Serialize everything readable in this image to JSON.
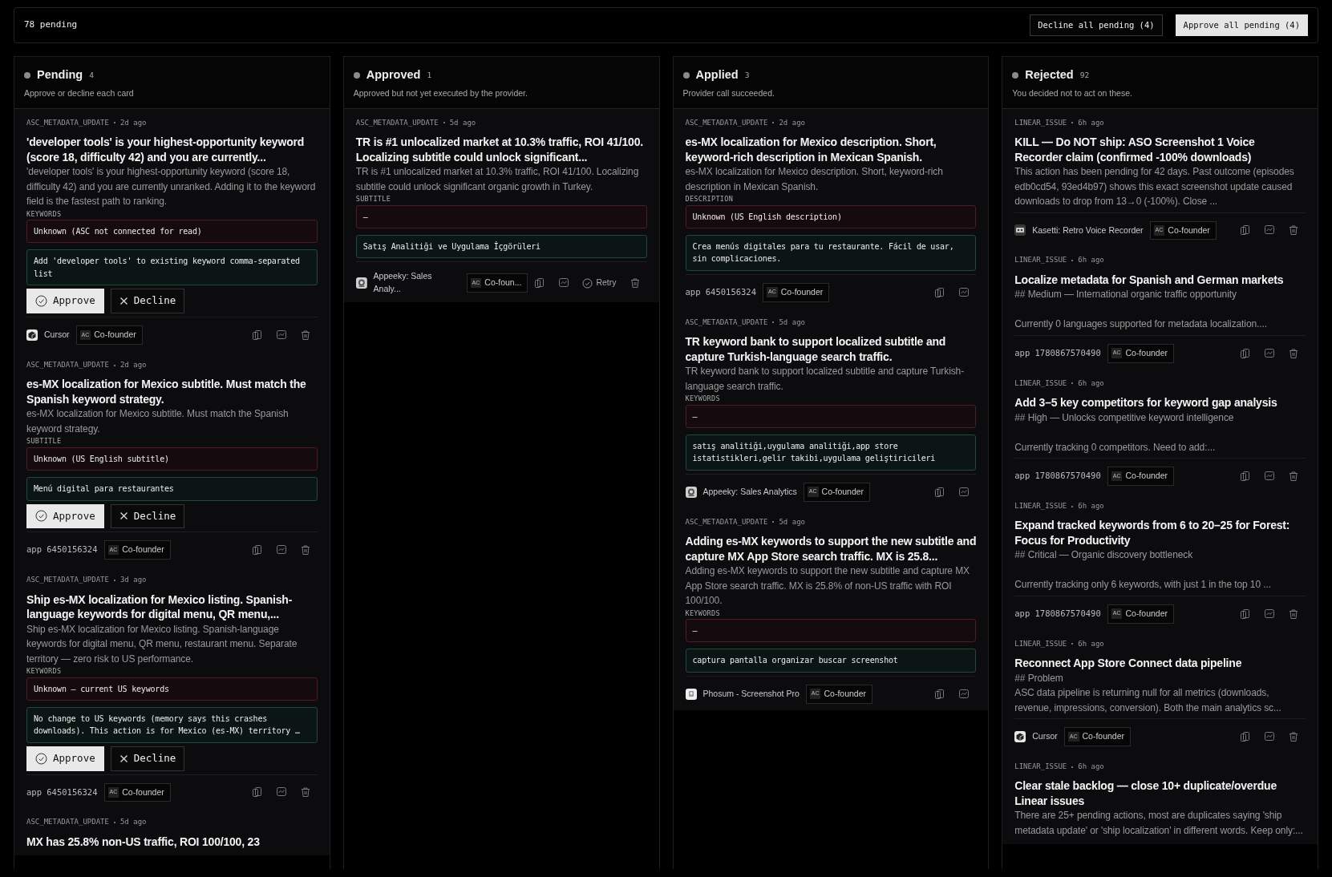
{
  "topbar": {
    "summary": "78 pending",
    "actions": [
      {
        "kind": "decline",
        "label": "Decline all pending (4)"
      },
      {
        "kind": "approve",
        "label": "Approve all pending (4)"
      }
    ]
  },
  "columns": [
    {
      "title": "Pending",
      "count": "4",
      "subtitle": "Approve or decline each card",
      "cards": [
        {
          "type": "ASC_METADATA_UPDATE",
          "age": "2d ago",
          "title": "'developer tools' is your highest-opportunity keyword (score 18, difficulty 42) and you are currently...",
          "description": "'developer tools' is your highest-opportunity keyword (score 18, difficulty 42) and you are currently unranked. Adding it to the keyword field is the fastest path to ranking.",
          "field": {
            "label": "KEYWORDS",
            "current": "Unknown (ASC not connected for read)",
            "proposed": "Add 'developer tools' to existing keyword comma-separated list"
          },
          "buttons": [
            {
              "kind": "approve",
              "label": "Approve"
            },
            {
              "kind": "decline",
              "label": "Decline"
            }
          ],
          "app": {
            "kind": "cursor",
            "name": "Cursor"
          },
          "badge": {
            "initials": "AC",
            "label": "Co-founder"
          },
          "actions": [
            {
              "kind": "copy"
            },
            {
              "kind": "chart"
            },
            {
              "kind": "trash"
            }
          ]
        },
        {
          "type": "ASC_METADATA_UPDATE",
          "age": "2d ago",
          "title": "es-MX localization for Mexico subtitle. Must match the Spanish keyword strategy.",
          "description": "es-MX localization for Mexico subtitle. Must match the Spanish keyword strategy.",
          "field": {
            "label": "SUBTITLE",
            "current": "Unknown (US English subtitle)",
            "proposed": "Menú digital para restaurantes"
          },
          "buttons": [
            {
              "kind": "approve",
              "label": "Approve"
            },
            {
              "kind": "decline",
              "label": "Decline"
            }
          ],
          "app": {
            "kind": "id",
            "name": "app 6450156324"
          },
          "badge": {
            "initials": "AC",
            "label": "Co-founder"
          },
          "actions": [
            {
              "kind": "copy"
            },
            {
              "kind": "chart"
            },
            {
              "kind": "trash"
            }
          ]
        },
        {
          "type": "ASC_METADATA_UPDATE",
          "age": "3d ago",
          "title": "Ship es-MX localization for Mexico listing. Spanish-language keywords for digital menu, QR menu,...",
          "description": "Ship es-MX localization for Mexico listing. Spanish-language keywords for digital menu, QR menu, restaurant menu. Separate territory — zero risk to US performance.",
          "field": {
            "label": "KEYWORDS",
            "current": "Unknown — current US keywords",
            "proposed": "No change to US keywords (memory says this crashes downloads). This action is for Mexico (es-MX) territory …"
          },
          "buttons": [
            {
              "kind": "approve",
              "label": "Approve"
            },
            {
              "kind": "decline",
              "label": "Decline"
            }
          ],
          "app": {
            "kind": "id",
            "name": "app 6450156324"
          },
          "badge": {
            "initials": "AC",
            "label": "Co-founder"
          },
          "actions": [
            {
              "kind": "copy"
            },
            {
              "kind": "chart"
            },
            {
              "kind": "trash"
            }
          ]
        },
        {
          "type": "ASC_METADATA_UPDATE",
          "age": "5d ago",
          "title": "MX has 25.8% non-US traffic, ROI 100/100, 23"
        }
      ]
    },
    {
      "title": "Approved",
      "count": "1",
      "subtitle": "Approved but not yet executed by the provider.",
      "cards": [
        {
          "type": "ASC_METADATA_UPDATE",
          "age": "5d ago",
          "title": "TR is #1 unlocalized market at 10.3% traffic, ROI 41/100. Localizing subtitle could unlock significant...",
          "description": "TR is #1 unlocalized market at 10.3% traffic, ROI 41/100. Localizing subtitle could unlock significant organic growth in Turkey.",
          "field": {
            "label": "SUBTITLE",
            "current": "–",
            "proposed": "Satış Analitiği ve Uygulama İçgörüleri"
          },
          "app": {
            "kind": "appeeky",
            "name": "Appeeky: Sales Analy..."
          },
          "badge": {
            "initials": "AC",
            "label": "Co-foun..."
          },
          "actions": [
            {
              "kind": "copy"
            },
            {
              "kind": "chart"
            },
            {
              "kind": "retry",
              "label": "Retry"
            },
            {
              "kind": "trash"
            }
          ]
        }
      ]
    },
    {
      "title": "Applied",
      "count": "3",
      "subtitle": "Provider call succeeded.",
      "cards": [
        {
          "type": "ASC_METADATA_UPDATE",
          "age": "2d ago",
          "title": "es-MX localization for Mexico description. Short, keyword-rich description in Mexican Spanish.",
          "description": "es-MX localization for Mexico description. Short, keyword-rich description in Mexican Spanish.",
          "field": {
            "label": "DESCRIPTION",
            "current": "Unknown (US English description)",
            "proposed": "Crea menús digitales para tu restaurante. Fácil de usar, sin complicaciones."
          },
          "app": {
            "kind": "id",
            "name": "app 6450156324"
          },
          "badge": {
            "initials": "AC",
            "label": "Co-founder"
          },
          "actions": [
            {
              "kind": "copy"
            },
            {
              "kind": "chart"
            }
          ]
        },
        {
          "type": "ASC_METADATA_UPDATE",
          "age": "5d ago",
          "title": "TR keyword bank to support localized subtitle and capture Turkish-language search traffic.",
          "description": "TR keyword bank to support localized subtitle and capture Turkish-language search traffic.",
          "field": {
            "label": "KEYWORDS",
            "current": "–",
            "proposed": "satış analitiği,uygulama analitiği,app store istatistikleri,gelir takibi,uygulama geliştiricileri"
          },
          "app": {
            "kind": "appeeky",
            "name": "Appeeky: Sales Analytics"
          },
          "badge": {
            "initials": "AC",
            "label": "Co-founder"
          },
          "actions": [
            {
              "kind": "copy"
            },
            {
              "kind": "chart"
            }
          ]
        },
        {
          "type": "ASC_METADATA_UPDATE",
          "age": "5d ago",
          "title": "Adding es-MX keywords to support the new subtitle and capture MX App Store search traffic. MX is 25.8...",
          "description": "Adding es-MX keywords to support the new subtitle and capture MX App Store search traffic. MX is 25.8% of non-US traffic with ROI 100/100.",
          "field": {
            "label": "KEYWORDS",
            "current": "–",
            "proposed": "captura pantalla organizar buscar screenshot"
          },
          "app": {
            "kind": "phosum",
            "name": "Phosum - Screenshot Pro"
          },
          "badge": {
            "initials": "AC",
            "label": "Co-founder"
          },
          "actions": [
            {
              "kind": "copy"
            },
            {
              "kind": "chart"
            }
          ]
        }
      ]
    },
    {
      "title": "Rejected",
      "count": "92",
      "subtitle": "You decided not to act on these.",
      "cards": [
        {
          "type": "LINEAR_ISSUE",
          "age": "6h ago",
          "title": "KILL — Do NOT ship: ASO Screenshot 1 Voice Recorder claim (confirmed -100% downloads)",
          "description": "This action has been pending for 42 days. Past outcome (episodes edb0cd54, 93ed4b97) shows this exact screenshot update caused downloads to drop from 13→0 (-100%). Close ...",
          "app": {
            "kind": "kasetti",
            "name": "Kasetti: Retro Voice Recorder"
          },
          "badge": {
            "initials": "AC",
            "label": "Co-founder"
          },
          "actions": [
            {
              "kind": "copy"
            },
            {
              "kind": "chart"
            },
            {
              "kind": "trash"
            }
          ]
        },
        {
          "type": "LINEAR_ISSUE",
          "age": "6h ago",
          "title": "Localize metadata for Spanish and German markets",
          "description": "## Medium — International organic traffic opportunity\n\nCurrently 0 languages supported for metadata localization....",
          "app": {
            "kind": "id",
            "name": "app 1780867570490"
          },
          "badge": {
            "initials": "AC",
            "label": "Co-founder"
          },
          "actions": [
            {
              "kind": "copy"
            },
            {
              "kind": "chart"
            },
            {
              "kind": "trash"
            }
          ]
        },
        {
          "type": "LINEAR_ISSUE",
          "age": "6h ago",
          "title": "Add 3–5 key competitors for keyword gap analysis",
          "description": "## High — Unlocks competitive keyword intelligence\n\nCurrently tracking 0 competitors. Need to add:...",
          "app": {
            "kind": "id",
            "name": "app 1780867570490"
          },
          "badge": {
            "initials": "AC",
            "label": "Co-founder"
          },
          "actions": [
            {
              "kind": "copy"
            },
            {
              "kind": "chart"
            },
            {
              "kind": "trash"
            }
          ]
        },
        {
          "type": "LINEAR_ISSUE",
          "age": "6h ago",
          "title": "Expand tracked keywords from 6 to 20–25 for Forest: Focus for Productivity",
          "description": "## Critical — Organic discovery bottleneck\n\nCurrently tracking only 6 keywords, with just 1 in the top 10 ...",
          "app": {
            "kind": "id",
            "name": "app 1780867570490"
          },
          "badge": {
            "initials": "AC",
            "label": "Co-founder"
          },
          "actions": [
            {
              "kind": "copy"
            },
            {
              "kind": "chart"
            },
            {
              "kind": "trash"
            }
          ]
        },
        {
          "type": "LINEAR_ISSUE",
          "age": "6h ago",
          "title": "Reconnect App Store Connect data pipeline",
          "description": "## Problem\nASC data pipeline is returning null for all metrics (downloads, revenue, impressions, conversion). Both the main analytics sc...",
          "app": {
            "kind": "cursor",
            "name": "Cursor"
          },
          "badge": {
            "initials": "AC",
            "label": "Co-founder"
          },
          "actions": [
            {
              "kind": "copy"
            },
            {
              "kind": "chart"
            },
            {
              "kind": "trash"
            }
          ]
        },
        {
          "type": "LINEAR_ISSUE",
          "age": "6h ago",
          "title": "Clear stale backlog — close 10+ duplicate/overdue Linear issues",
          "description": "There are 25+ pending actions, most are duplicates saying 'ship metadata update' or 'ship localization' in different words. Keep only:..."
        }
      ]
    }
  ]
}
